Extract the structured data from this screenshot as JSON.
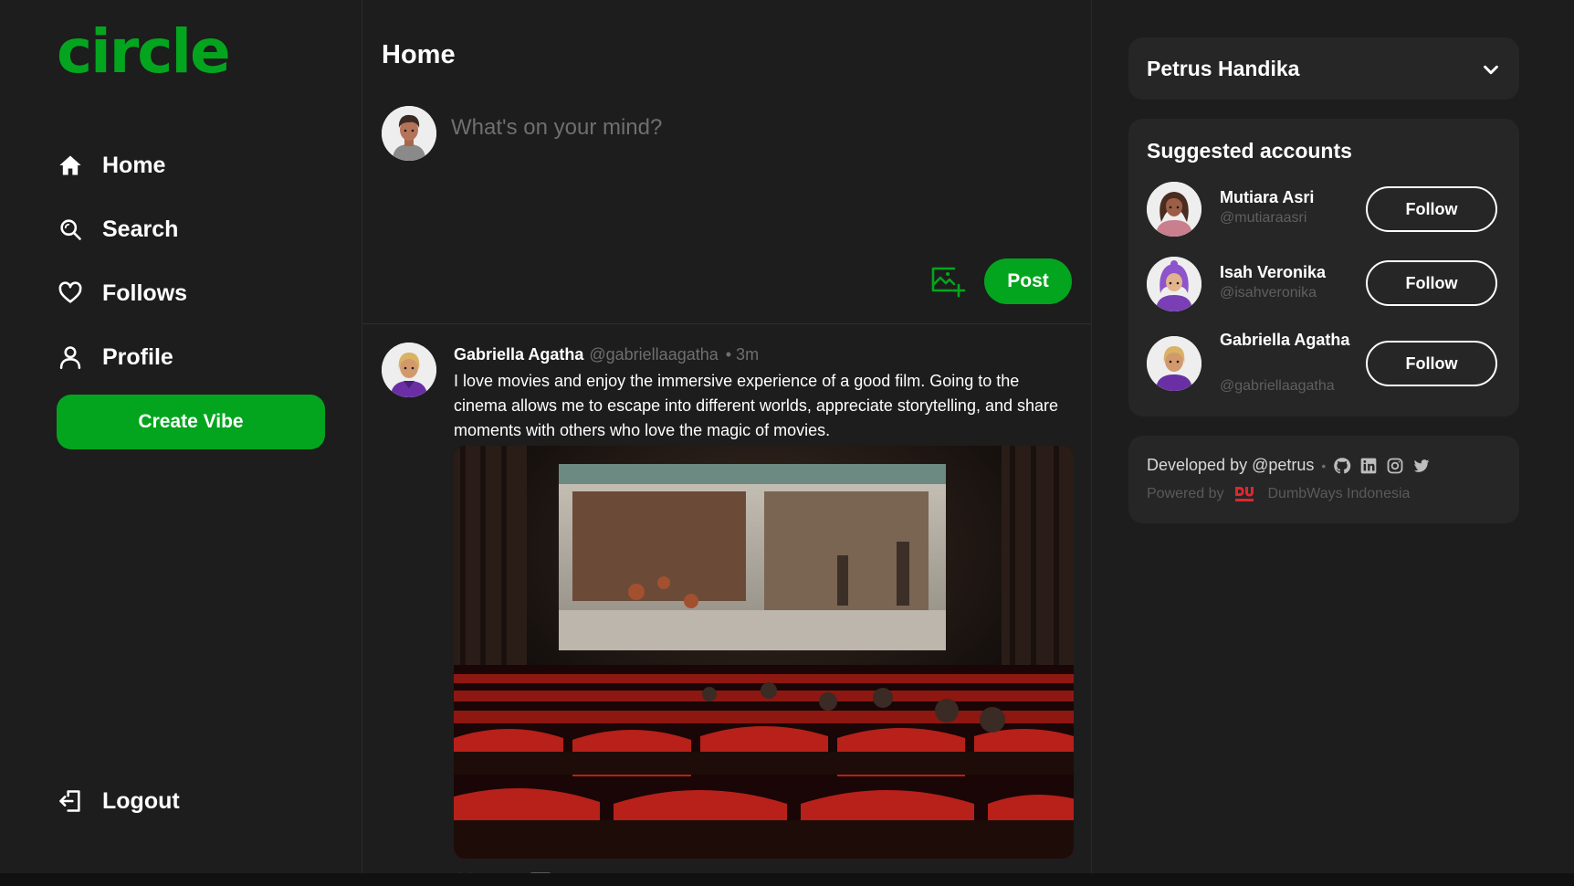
{
  "app": {
    "logo": "circle",
    "brand_color": "#04a51e"
  },
  "sidebar": {
    "nav": [
      {
        "label": "Home",
        "icon": "home-icon"
      },
      {
        "label": "Search",
        "icon": "search-icon"
      },
      {
        "label": "Follows",
        "icon": "heart-icon"
      },
      {
        "label": "Profile",
        "icon": "user-icon"
      }
    ],
    "create_label": "Create Vibe",
    "logout_label": "Logout"
  },
  "main": {
    "title": "Home",
    "composer": {
      "placeholder": "What's on your mind?",
      "post_label": "Post"
    },
    "thread": {
      "name": "Gabriella Agatha",
      "handle": "@gabriellaagatha",
      "time": "• 3m",
      "content": "I love movies and enjoy the immersive experience of a good film. Going to the cinema allows me to escape into different worlds, appreciate storytelling, and share moments with others who love the magic of movies."
    }
  },
  "right": {
    "profile": {
      "name": "Petrus Handika"
    },
    "suggested": {
      "title": "Suggested accounts",
      "accounts": [
        {
          "name": "Mutiara Asri",
          "handle": "@mutiaraasri",
          "follow_label": "Follow"
        },
        {
          "name": "Isah Veronika",
          "handle": "@isahveronika",
          "follow_label": "Follow"
        },
        {
          "name": "Gabriella Agatha",
          "handle": "@gabriellaagatha",
          "follow_label": "Follow"
        }
      ]
    },
    "footer": {
      "developed_by": "Developed by @petrus",
      "dot": "•",
      "powered_by": "Powered by",
      "company": "DumbWays Indonesia",
      "social_icons": [
        "github-icon",
        "linkedin-icon",
        "instagram-icon",
        "twitter-icon"
      ]
    }
  }
}
